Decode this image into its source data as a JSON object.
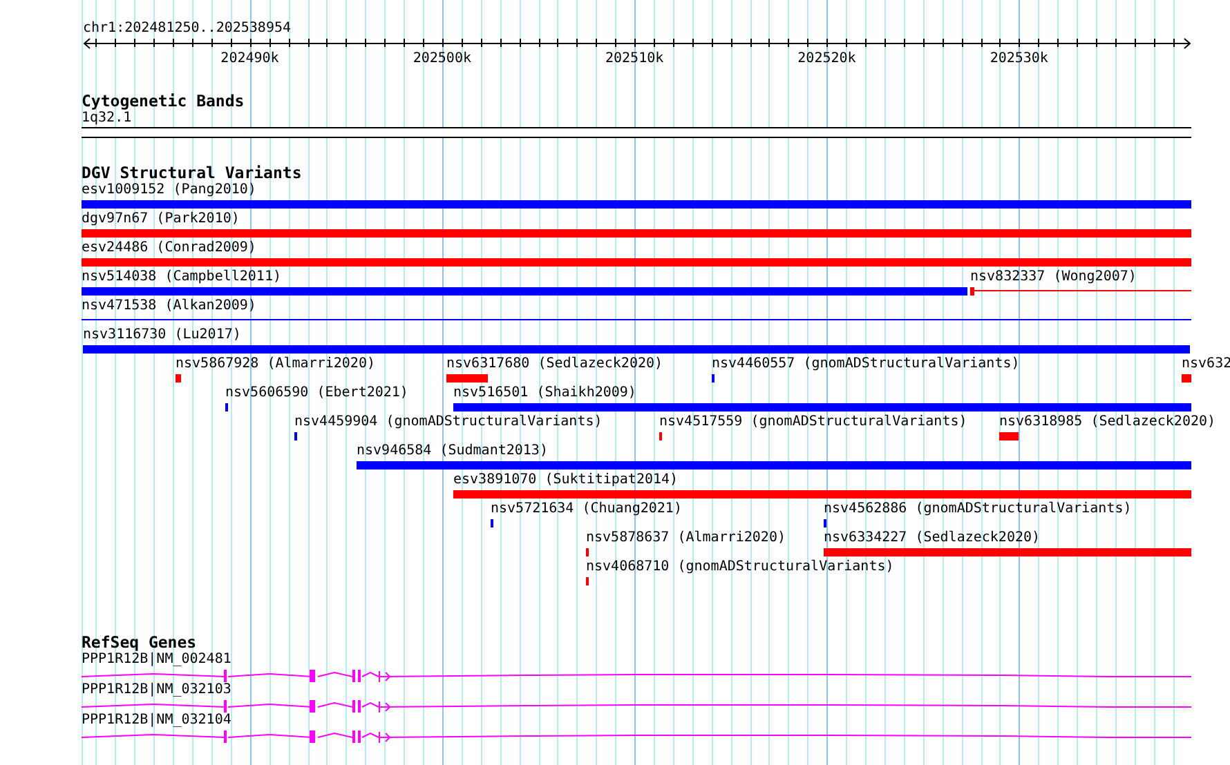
{
  "locus": "chr1:202481250..202538954",
  "ruler": {
    "labels": [
      "202490k",
      "202500k",
      "202510k",
      "202520k",
      "202530k"
    ]
  },
  "tracks": [
    {
      "kind": "bands",
      "title": "Cytogenetic Bands",
      "features": [
        {
          "label": "1q32.1"
        }
      ]
    },
    {
      "kind": "variants",
      "title": "DGV Structural Variants",
      "features": [
        {
          "label": "esv1009152 (Pang2010)",
          "color": "#0000ff",
          "kind": "bar"
        },
        {
          "label": "dgv97n67 (Park2010)",
          "color": "#ff0000",
          "kind": "bar"
        },
        {
          "label": "esv24486 (Conrad2009)",
          "color": "#ff0000",
          "kind": "bar"
        },
        {
          "label": "nsv514038 (Campbell2011)",
          "color": "#0000ff",
          "kind": "bar"
        },
        {
          "label": "nsv832337 (Wong2007)",
          "color": "#ff0000",
          "kind": "box-line"
        },
        {
          "label": "nsv471538 (Alkan2009)",
          "color": "#0000ff",
          "kind": "line"
        },
        {
          "label": "nsv3116730 (Lu2017)",
          "color": "#0000ff",
          "kind": "bar"
        },
        {
          "label": "nsv5867928 (Almarri2020)",
          "color": "#ff0000",
          "kind": "bar"
        },
        {
          "label": "nsv6317680 (Sedlazeck2020)",
          "color": "#ff0000",
          "kind": "bar"
        },
        {
          "label": "nsv4460557 (gnomADStructuralVariants)",
          "color": "#0000ff",
          "kind": "bar"
        },
        {
          "label": "nsv632",
          "color": "#ff0000",
          "kind": "bar"
        },
        {
          "label": "nsv5606590 (Ebert2021)",
          "color": "#0000ff",
          "kind": "bar"
        },
        {
          "label": "nsv516501 (Shaikh2009)",
          "color": "#0000ff",
          "kind": "bar"
        },
        {
          "label": "nsv4459904 (gnomADStructuralVariants)",
          "color": "#0000ff",
          "kind": "bar"
        },
        {
          "label": "nsv4517559 (gnomADStructuralVariants)",
          "color": "#ff0000",
          "kind": "bar"
        },
        {
          "label": "nsv6318985 (Sedlazeck2020)",
          "color": "#ff0000",
          "kind": "bar"
        },
        {
          "label": "nsv946584 (Sudmant2013)",
          "color": "#0000ff",
          "kind": "bar"
        },
        {
          "label": "esv3891070 (Suktitipat2014)",
          "color": "#ff0000",
          "kind": "bar"
        },
        {
          "label": "nsv5721634 (Chuang2021)",
          "color": "#0000ff",
          "kind": "bar"
        },
        {
          "label": "nsv4562886 (gnomADStructuralVariants)",
          "color": "#0000ff",
          "kind": "bar"
        },
        {
          "label": "nsv5878637 (Almarri2020)",
          "color": "#ff0000",
          "kind": "bar"
        },
        {
          "label": "nsv6334227 (Sedlazeck2020)",
          "color": "#ff0000",
          "kind": "bar"
        },
        {
          "label": "nsv4068710 (gnomADStructuralVariants)",
          "color": "#ff0000",
          "kind": "bar"
        }
      ]
    },
    {
      "kind": "genes",
      "title": "RefSeq Genes",
      "features": [
        {
          "label": "PPP1R12B|NM_002481"
        },
        {
          "label": "PPP1R12B|NM_032103"
        },
        {
          "label": "PPP1R12B|NM_032104"
        }
      ]
    }
  ]
}
